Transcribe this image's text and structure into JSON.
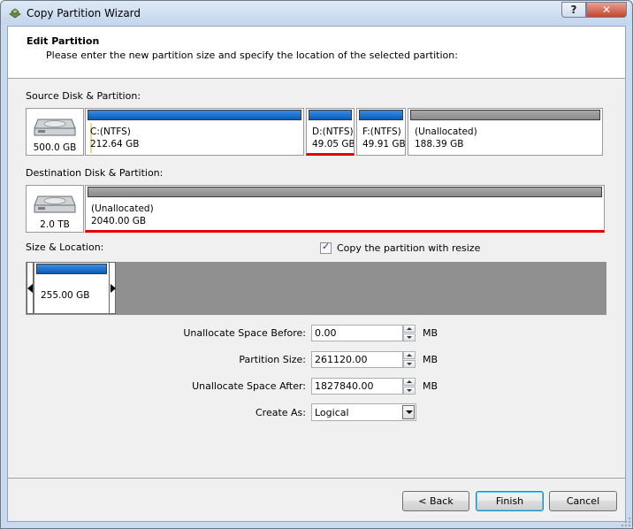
{
  "window": {
    "title": "Copy Partition Wizard",
    "help_label": "?",
    "close_label": "✕"
  },
  "header": {
    "title": "Edit Partition",
    "subtitle": "Please enter the new partition size and specify the location of the selected partition:"
  },
  "source": {
    "label": "Source Disk & Partition:",
    "disk_size": "500.0 GB",
    "partitions": [
      {
        "name": "C:(NTFS)",
        "size": "212.64 GB"
      },
      {
        "name": "D:(NTFS)",
        "size": "49.05 GB"
      },
      {
        "name": "F:(NTFS)",
        "size": "49.91 GB"
      },
      {
        "name": "(Unallocated)",
        "size": "188.39 GB"
      }
    ]
  },
  "destination": {
    "label": "Destination Disk & Partition:",
    "disk_size": "2.0 TB",
    "partitions": [
      {
        "name": "(Unallocated)",
        "size": "2040.00 GB"
      }
    ]
  },
  "size_location": {
    "label": "Size & Location:",
    "copy_with_resize_label": "Copy the partition with resize",
    "copy_with_resize_checked": true,
    "partition_size": "255.00 GB"
  },
  "form": {
    "unalloc_before": {
      "label": "Unallocate Space Before:",
      "value": "0.00",
      "unit": "MB"
    },
    "partition_size": {
      "label": "Partition Size:",
      "value": "261120.00",
      "unit": "MB"
    },
    "unalloc_after": {
      "label": "Unallocate Space After:",
      "value": "1827840.00",
      "unit": "MB"
    },
    "create_as": {
      "label": "Create As:",
      "value": "Logical"
    }
  },
  "buttons": {
    "back": "< Back",
    "finish": "Finish",
    "cancel": "Cancel"
  },
  "colors": {
    "selected_marker": "#e30000",
    "ntfs_bar": "#0a5cb8",
    "unallocated_bar": "#8a8a8a"
  }
}
